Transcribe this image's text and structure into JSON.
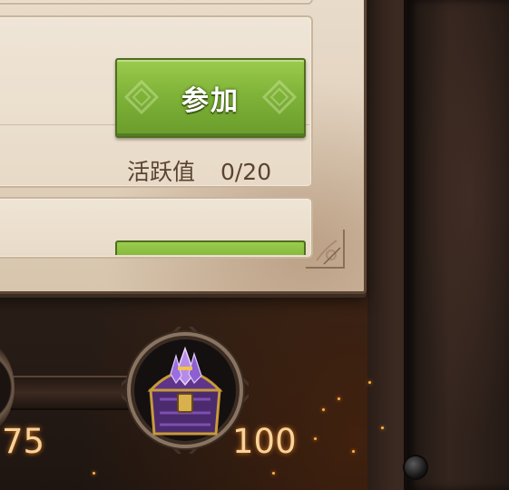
{
  "event_row": {
    "join_button_label": "参加",
    "activity_label": "活跃值",
    "activity_value": "0/20"
  },
  "reward_track": {
    "milestones": [
      {
        "value": "75",
        "reward": "chest"
      },
      {
        "value": "100",
        "reward": "purple-gold-chest"
      }
    ]
  },
  "colors": {
    "button_green": "#7fb338",
    "parchment": "#e2d3bf",
    "milestone_text": "#f6d39a"
  }
}
